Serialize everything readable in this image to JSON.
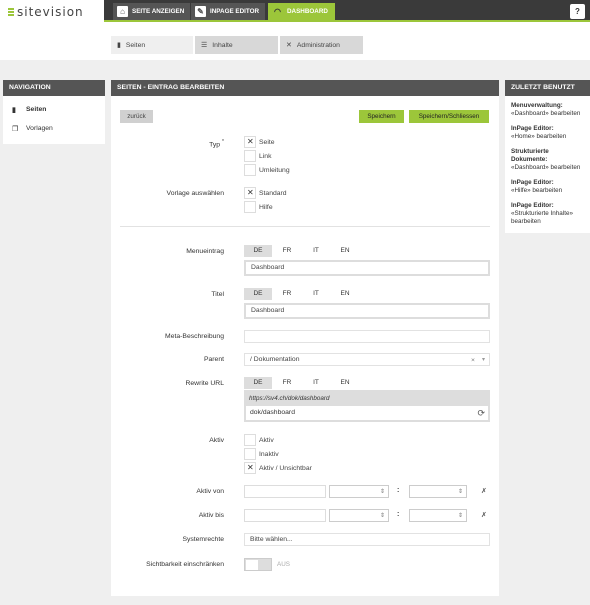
{
  "brand": {
    "logo_text": "sitevision"
  },
  "topbar": {
    "buttons": [
      {
        "label": "SEITE ANZEIGEN",
        "icon": "home-icon"
      },
      {
        "label": "INPAGE EDITOR",
        "icon": "edit-icon"
      },
      {
        "label": "DASHBOARD",
        "icon": "gauge-icon"
      }
    ],
    "help": "?"
  },
  "tabs": [
    {
      "label": "Seiten",
      "icon": "page-icon"
    },
    {
      "label": "Inhalte",
      "icon": "list-icon"
    },
    {
      "label": "Administration",
      "icon": "tools-icon"
    }
  ],
  "navigation": {
    "title": "NAVIGATION",
    "items": [
      {
        "label": "Seiten",
        "icon": "page-icon"
      },
      {
        "label": "Vorlagen",
        "icon": "copy-icon"
      }
    ]
  },
  "editor": {
    "title": "SEITEN - EINTRAG BEARBEITEN",
    "back": "zurück",
    "save": "Speichern",
    "save_close": "Speichern/Schliessen",
    "typ": {
      "label": "Typ",
      "required": "*",
      "options": [
        "Seite",
        "Link",
        "Umleitung"
      ],
      "selected": "Seite"
    },
    "vorlage": {
      "label": "Vorlage auswählen",
      "options": [
        "Standard",
        "Hilfe"
      ],
      "selected": "Standard"
    },
    "languages": [
      "DE",
      "FR",
      "IT",
      "EN"
    ],
    "menueintrag": {
      "label": "Menueintrag",
      "value": "Dashboard"
    },
    "titel": {
      "label": "Titel",
      "value": "Dashboard"
    },
    "meta": {
      "label": "Meta-Beschreibung",
      "value": ""
    },
    "parent": {
      "label": "Parent",
      "value": "/ Dokumentation",
      "clear": "×",
      "arrow": "▾"
    },
    "rewrite": {
      "label": "Rewrite URL",
      "prefix": "https://sv4.ch/dok/dashboard",
      "value": "dok/dashboard"
    },
    "aktiv": {
      "label": "Aktiv",
      "options": [
        "Aktiv",
        "Inaktiv",
        "Aktiv / Unsichtbar"
      ],
      "selected": "Aktiv / Unsichtbar"
    },
    "aktiv_von": {
      "label": "Aktiv von"
    },
    "aktiv_bis": {
      "label": "Aktiv bis"
    },
    "time_separator": ":",
    "clear_x": "✗",
    "systemrechte": {
      "label": "Systemrechte",
      "placeholder": "Bitte wählen..."
    },
    "sichtbarkeit": {
      "label": "Sichtbarkeit einschränken",
      "toggle": "AUS"
    }
  },
  "recent": {
    "title": "ZULETZT BENUTZT",
    "items": [
      {
        "name": "Menuverwaltung:",
        "detail": "«Dashboard» bearbeiten"
      },
      {
        "name": "InPage Editor:",
        "detail": "«Home» bearbeiten"
      },
      {
        "name": "Strukturierte Dokumente:",
        "detail": "«Dashboard» bearbeiten"
      },
      {
        "name": "InPage Editor:",
        "detail": "«Hilfe» bearbeiten"
      },
      {
        "name": "InPage Editor:",
        "detail": "«Strukturierte Inhalte» bearbeiten"
      }
    ]
  },
  "colors": {
    "accent": "#9cc63a",
    "header": "#555555",
    "topbar": "#3a3a3a"
  }
}
